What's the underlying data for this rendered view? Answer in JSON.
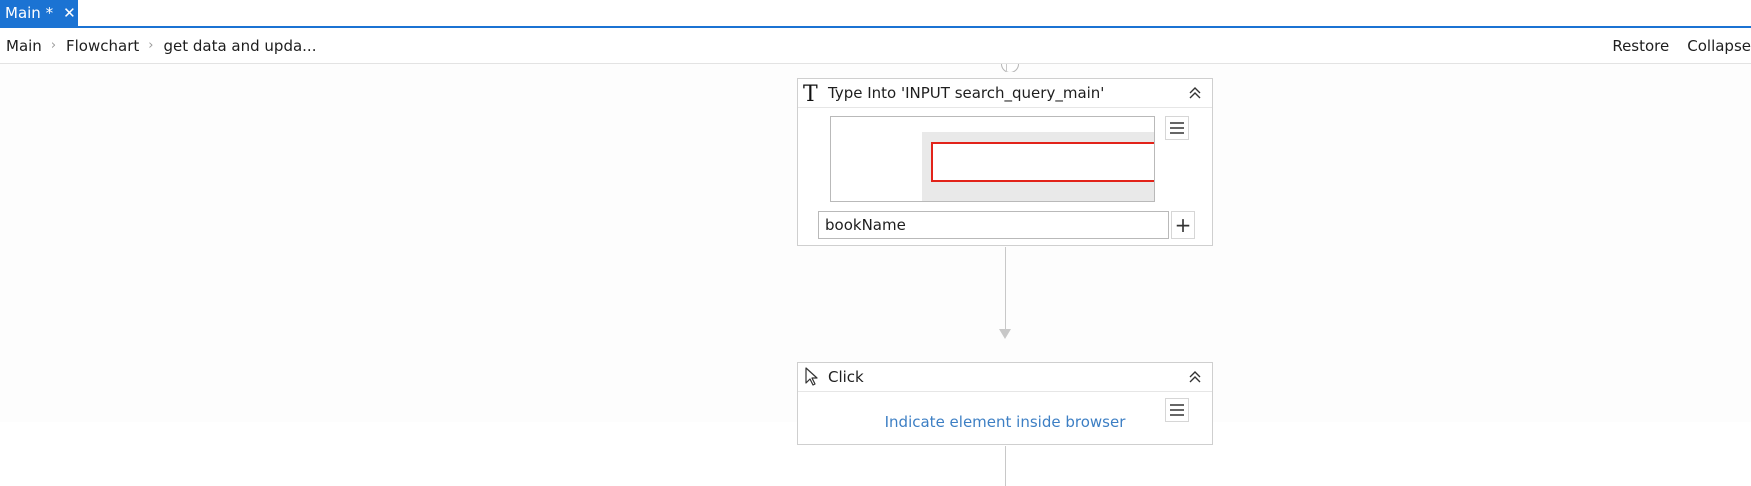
{
  "tab": {
    "label": "Main *",
    "close_glyph": "✕"
  },
  "breadcrumb": {
    "items": [
      "Main",
      "Flowchart",
      "get data and upda..."
    ],
    "separator": "›",
    "actions": {
      "restore": "Restore",
      "collapse": "Collapse"
    }
  },
  "activities": {
    "type_into": {
      "icon": "type-into-icon",
      "title": "Type Into 'INPUT  search_query_main'",
      "text_value": "bookName",
      "plus_label": "+"
    },
    "click": {
      "icon": "pointer-icon",
      "title": "Click",
      "indicate_text": "Indicate element inside browser"
    }
  },
  "colors": {
    "accent": "#1b73d3",
    "selection_red": "#e2231a",
    "link_blue": "#3d7fc4"
  }
}
